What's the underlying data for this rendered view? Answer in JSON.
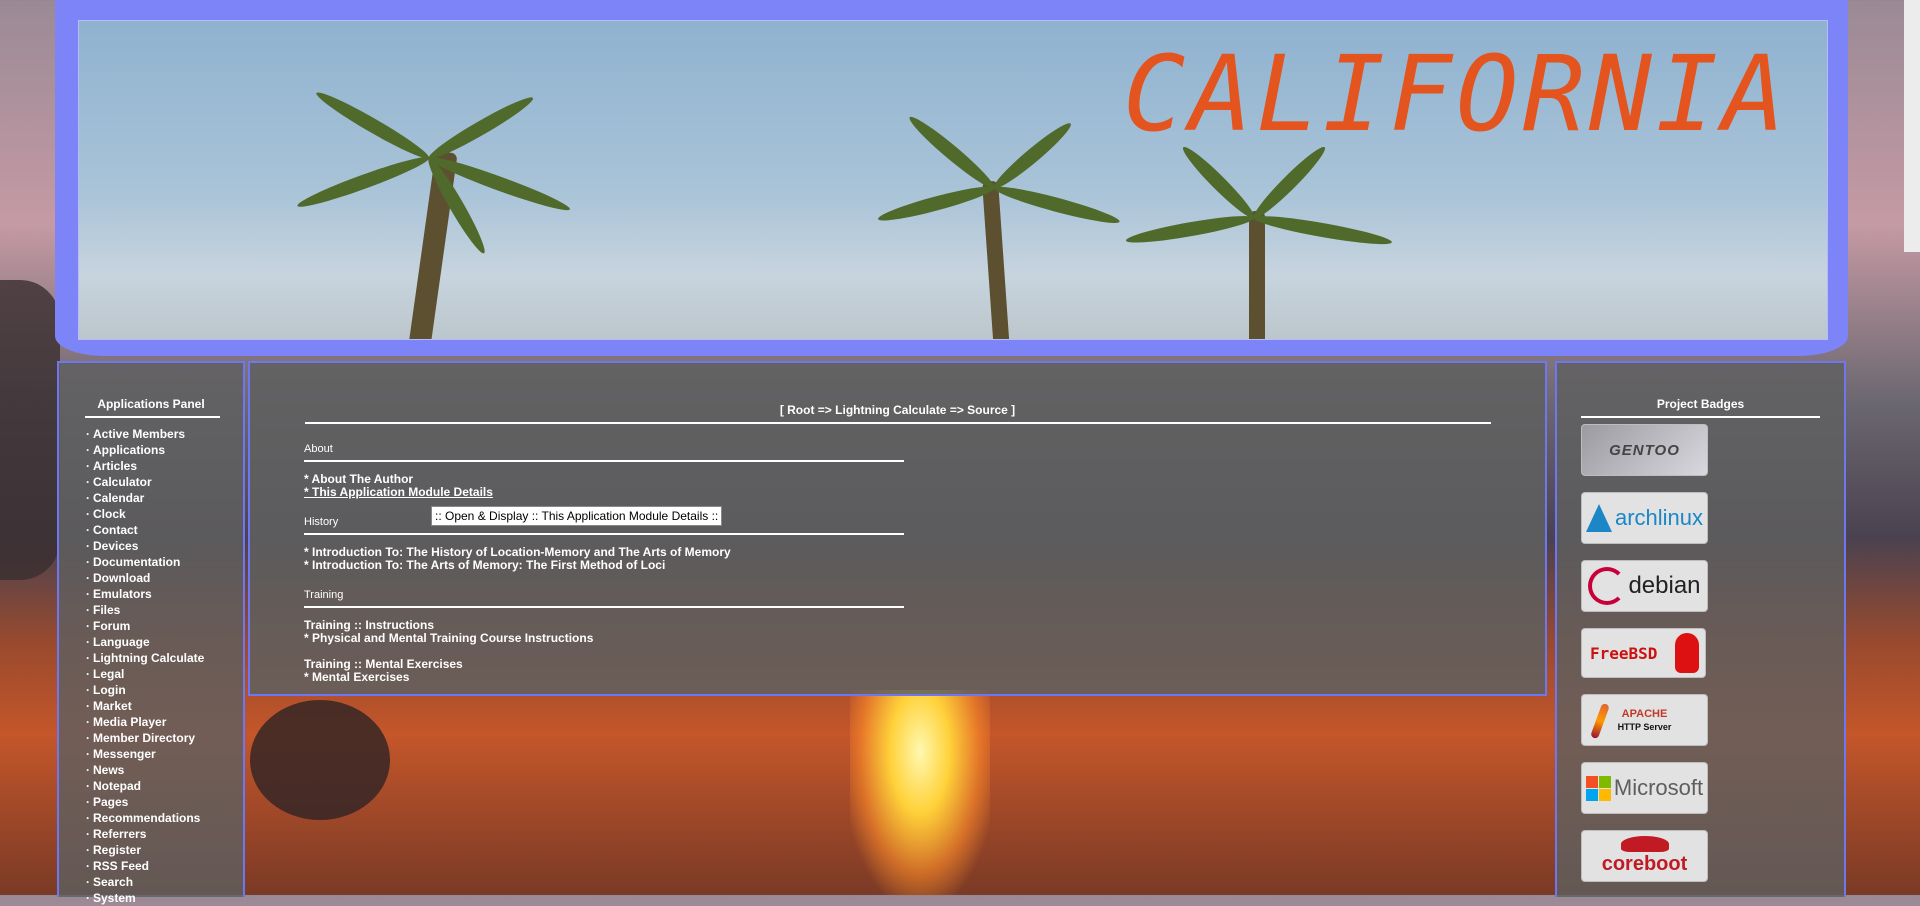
{
  "header": {
    "title": "CALIFORNIA"
  },
  "left_sidebar": {
    "title": "Applications Panel",
    "items": [
      "Active Members",
      "Applications",
      "Articles",
      "Calculator",
      "Calendar",
      "Clock",
      "Contact",
      "Devices",
      "Documentation",
      "Download",
      "Emulators",
      "Files",
      "Forum",
      "Language",
      "Lightning Calculate",
      "Legal",
      "Login",
      "Market",
      "Media Player",
      "Member Directory",
      "Messenger",
      "News",
      "Notepad",
      "Pages",
      "Recommendations",
      "Referrers",
      "Register",
      "RSS Feed",
      "Search",
      "System"
    ],
    "bullet": "·"
  },
  "main": {
    "breadcrumb": "[ Root => Lightning Calculate => Source ]",
    "sections": {
      "about": {
        "title": "About",
        "links": [
          "* About The Author",
          "* This Application Module Details"
        ]
      },
      "history": {
        "title": "History",
        "links": [
          "* Introduction To: The History of Location-Memory and The Arts of Memory",
          "* Introduction To: The Arts of Memory: The First Method of Loci"
        ]
      },
      "training": {
        "title": "Training",
        "group1_title": "Training :: Instructions",
        "group1_link": "* Physical and Mental Training Course Instructions",
        "group2_title": "Training :: Mental Exercises",
        "group2_link": "* Mental Exercises"
      }
    },
    "tooltip": ":: Open & Display :: This Application Module Details ::"
  },
  "right_sidebar": {
    "title": "Project Badges",
    "badges": {
      "gentoo": "GENTOO",
      "arch": "archlinux",
      "debian": "debian",
      "freebsd": "FreeBSD",
      "apache": "APACHE",
      "apache_sub": "HTTP Server",
      "microsoft": "Microsoft",
      "coreboot": "coreboot"
    }
  },
  "colors": {
    "accent_border": "#6e76f0",
    "header_frame": "#7d84f8",
    "title_orange": "#e4541f",
    "panel_bg": "#5f5f5f"
  }
}
